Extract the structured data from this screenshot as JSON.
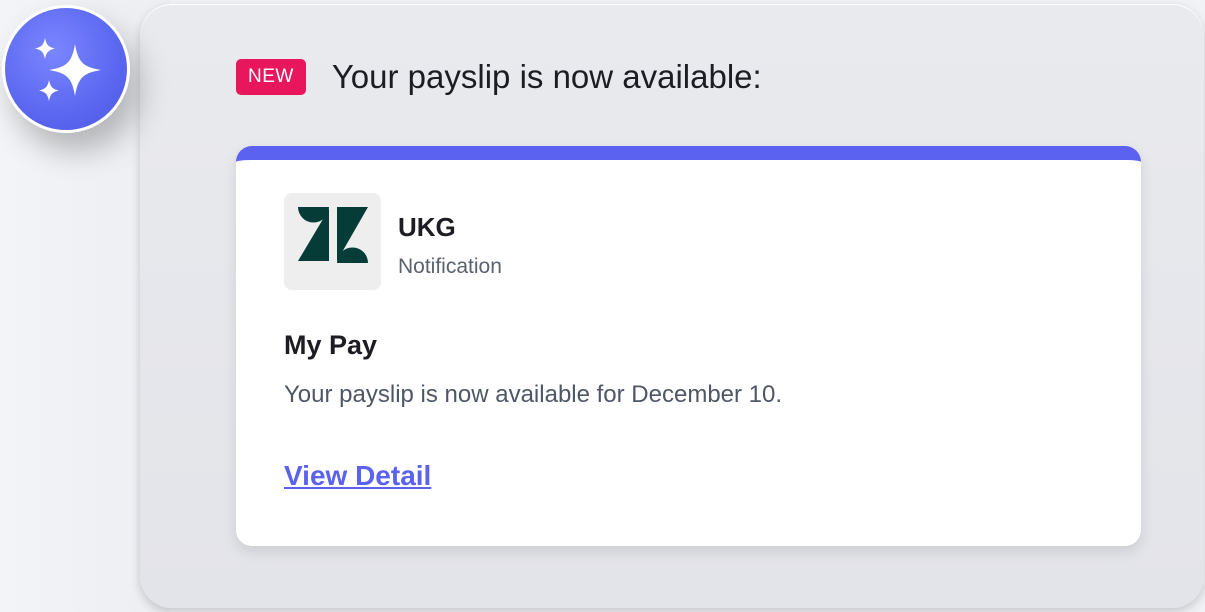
{
  "badge": {
    "label": "NEW",
    "color": "#e8175d"
  },
  "header": {
    "title": "Your payslip is now available:"
  },
  "assistant": {
    "icon": "sparkles-icon",
    "color": "#5b67f0"
  },
  "card": {
    "accent_color": "#5b62f0",
    "app": {
      "logo_icon": "zendesk-logo-icon",
      "name": "UKG",
      "subtitle": "Notification"
    },
    "title": "My Pay",
    "body": "Your payslip is now available for December 10.",
    "link_label": "View Detail"
  }
}
